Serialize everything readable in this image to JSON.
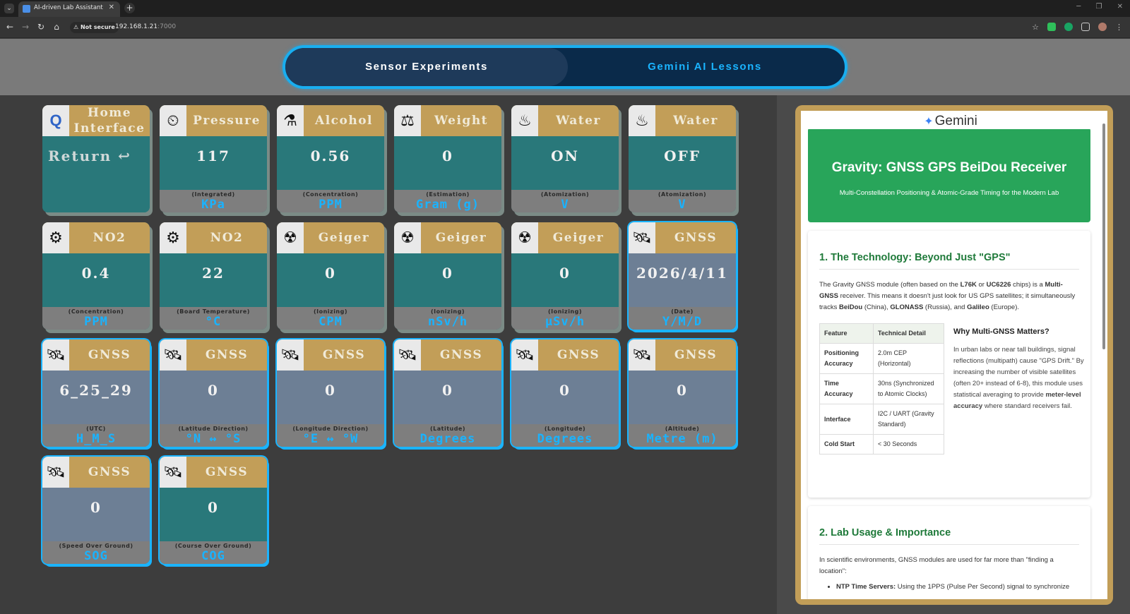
{
  "browser": {
    "tab_title": "AI-driven Lab Assistant",
    "security_label": "Not secure",
    "url_host": "192.168.1.21",
    "url_port": ":7000"
  },
  "switcher": {
    "tabs": [
      {
        "label": "Sensor Experiments",
        "active": true
      },
      {
        "label": "Gemini AI Lessons",
        "active": false
      }
    ]
  },
  "cards": [
    {
      "title": "Home Interface",
      "value": "Return ↩",
      "sub": "",
      "unit": "",
      "icon": "qualcomm-logo-icon",
      "icon_glyph": "Q",
      "body": "teal"
    },
    {
      "title": "Pressure",
      "value": "117",
      "sub": "(Integrated)",
      "unit": "KPa",
      "icon": "pressure-gauge-icon",
      "icon_glyph": "⏲",
      "body": "teal"
    },
    {
      "title": "Alcohol",
      "value": "0.56",
      "sub": "(Concentration)",
      "unit": "PPM",
      "icon": "alcohol-sensor-icon",
      "icon_glyph": "⚗",
      "body": "teal"
    },
    {
      "title": "Weight",
      "value": "0",
      "sub": "(Estimation)",
      "unit": "Gram (g)",
      "icon": "scale-icon",
      "icon_glyph": "⚖",
      "body": "teal"
    },
    {
      "title": "Water",
      "value": "ON",
      "sub": "(Atomization)",
      "unit": "V",
      "icon": "water-vapor-icon",
      "icon_glyph": "♨",
      "body": "teal"
    },
    {
      "title": "Water",
      "value": "OFF",
      "sub": "(Atomization)",
      "unit": "V",
      "icon": "water-vapor-icon",
      "icon_glyph": "♨",
      "body": "teal"
    },
    {
      "title": "NO2",
      "value": "0.4",
      "sub": "(Concentration)",
      "unit": "PPM",
      "icon": "no2-gear-icon",
      "icon_glyph": "⚙",
      "body": "teal"
    },
    {
      "title": "NO2",
      "value": "22",
      "sub": "(Board Temperature)",
      "unit": "°C",
      "icon": "no2-gear-icon",
      "icon_glyph": "⚙",
      "body": "teal"
    },
    {
      "title": "Geiger",
      "value": "0",
      "sub": "(Ionizing)",
      "unit": "CPM",
      "icon": "geiger-counter-icon",
      "icon_glyph": "☢",
      "body": "teal"
    },
    {
      "title": "Geiger",
      "value": "0",
      "sub": "(Ionizing)",
      "unit": "nSv/h",
      "icon": "geiger-counter-icon",
      "icon_glyph": "☢",
      "body": "teal"
    },
    {
      "title": "Geiger",
      "value": "0",
      "sub": "(Ionizing)",
      "unit": "μSv/h",
      "icon": "geiger-counter-icon",
      "icon_glyph": "☢",
      "body": "teal"
    },
    {
      "title": "GNSS",
      "value": "2026/4/11",
      "sub": "(Date)",
      "unit": "Y/M/D",
      "icon": "satellite-icon",
      "icon_glyph": "🛰",
      "body": "slate"
    },
    {
      "title": "GNSS",
      "value": "6_25_29",
      "sub": "(UTC)",
      "unit": "H_M_S",
      "icon": "satellite-icon",
      "icon_glyph": "🛰",
      "body": "slate"
    },
    {
      "title": "GNSS",
      "value": "0",
      "sub": "(Latitude Direction)",
      "unit": "°N ↔ °S",
      "icon": "satellite-icon",
      "icon_glyph": "🛰",
      "body": "slate"
    },
    {
      "title": "GNSS",
      "value": "0",
      "sub": "(Longitude Direction)",
      "unit": "°E ↔ °W",
      "icon": "satellite-icon",
      "icon_glyph": "🛰",
      "body": "slate"
    },
    {
      "title": "GNSS",
      "value": "0",
      "sub": "(Latitude)",
      "unit": "Degrees",
      "icon": "satellite-icon",
      "icon_glyph": "🛰",
      "body": "slate"
    },
    {
      "title": "GNSS",
      "value": "0",
      "sub": "(Longitude)",
      "unit": "Degrees",
      "icon": "satellite-icon",
      "icon_glyph": "🛰",
      "body": "slate"
    },
    {
      "title": "GNSS",
      "value": "0",
      "sub": "(Altitude)",
      "unit": "Metre (m)",
      "icon": "satellite-icon",
      "icon_glyph": "🛰",
      "body": "slate"
    },
    {
      "title": "GNSS",
      "value": "0",
      "sub": "(Speed Over Ground)",
      "unit": "SOG",
      "icon": "satellite-icon",
      "icon_glyph": "🛰",
      "body": "slate"
    },
    {
      "title": "GNSS",
      "value": "0",
      "sub": "(Course Over Ground)",
      "unit": "COG",
      "icon": "satellite-icon",
      "icon_glyph": "🛰",
      "body": "teal"
    }
  ],
  "gemini": {
    "logo": "Gemini",
    "hero_title": "Gravity: GNSS GPS BeiDou Receiver",
    "hero_subtitle": "Multi-Constellation Positioning & Atomic-Grade Timing for the Modern Lab",
    "section1_title": "1. The Technology: Beyond Just \"GPS\"",
    "section1_p_parts": [
      "The Gravity GNSS module (often based on the ",
      "L76K",
      " or ",
      "UC6226",
      " chips) is a ",
      "Multi-GNSS",
      " receiver. This means it doesn't just look for US GPS satellites; it simultaneously tracks ",
      "BeiDou",
      " (China), ",
      "GLONASS",
      " (Russia), and ",
      "Galileo",
      " (Europe)."
    ],
    "table_headers": [
      "Feature",
      "Technical Detail"
    ],
    "table_rows": [
      [
        "Positioning Accuracy",
        "2.0m CEP (Horizontal)"
      ],
      [
        "Time Accuracy",
        "30ns (Synchronized to Atomic Clocks)"
      ],
      [
        "Interface",
        "I2C / UART (Gravity Standard)"
      ],
      [
        "Cold Start",
        "< 30 Seconds"
      ]
    ],
    "why_title": "Why Multi-GNSS Matters?",
    "why_text_a": "In urban labs or near tall buildings, signal reflections (multipath) cause \"GPS Drift.\" By increasing the number of visible satellites (often 20+ instead of 6-8), this module uses statistical averaging to provide ",
    "why_bold": "meter-level accuracy",
    "why_text_b": " where standard receivers fail.",
    "section2_title": "2. Lab Usage & Importance",
    "section2_p": "In scientific environments, GNSS modules are used for far more than \"finding a location\":",
    "bullet1_bold": "NTP Time Servers:",
    "bullet1_text": " Using the 1PPS (Pulse Per Second) signal to synchronize"
  }
}
